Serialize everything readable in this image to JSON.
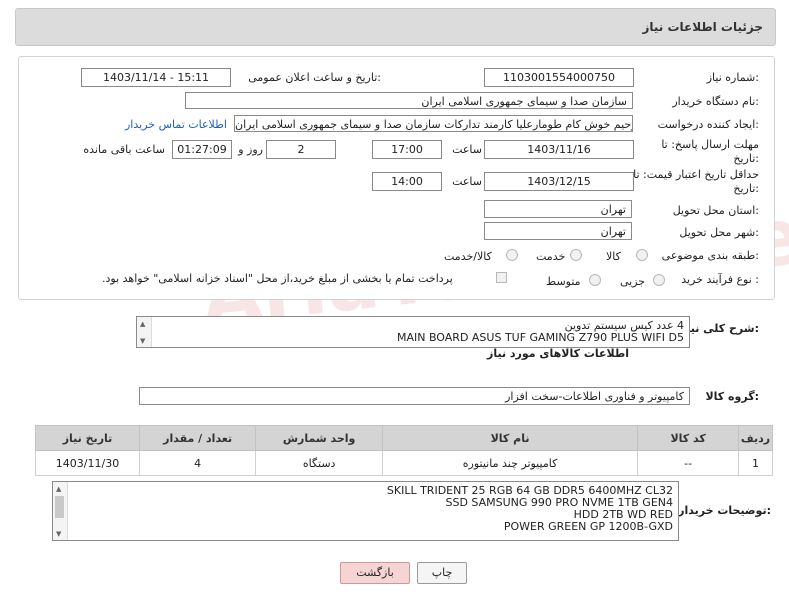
{
  "header": {
    "title": "جزئیات اطلاعات نیاز"
  },
  "fields": {
    "need_number_label": "شماره نیاز:",
    "need_number": "1103001554000750",
    "announce_label": "تاریخ و ساعت اعلان عمومی:",
    "announce_value": "1403/11/14 - 15:11",
    "buyer_org_label": "نام دستگاه خریدار:",
    "buyer_org": "سازمان صدا و سیمای جمهوری اسلامی ایران",
    "creator_label": "ایجاد کننده درخواست:",
    "creator": "رحیم خوش کام طومارعلیا کارمند تدارکات سازمان صدا و سیمای جمهوری اسلامی ایران",
    "contact_link": "اطلاعات تماس خریدار",
    "reply_deadline_label": "مهلت ارسال پاسخ: تا تاریخ:",
    "reply_date": "1403/11/16",
    "hour_label": "ساعت",
    "reply_time": "17:00",
    "days_count": "2",
    "days_label": "روز و",
    "remaining_time": "01:27:09",
    "remaining_label": "ساعت باقی مانده",
    "price_validity_label": "حداقل تاریخ اعتبار قیمت: تا تاریخ:",
    "price_date": "1403/12/15",
    "price_hour_label": "ساعت",
    "price_time": "14:00",
    "province_label": "استان محل تحویل:",
    "province": "تهران",
    "city_label": "شهر محل تحویل:",
    "city": "تهران",
    "category_label": "طبقه بندی موضوعی:",
    "category_options": [
      "کالا",
      "خدمت",
      "کالا/خدمت"
    ],
    "process_label": "نوع فرآیند خرید :",
    "process_options": [
      "جزیی",
      "متوسط"
    ],
    "payment_note": "پرداخت تمام یا بخشی از مبلغ خرید،از محل \"اسناد خزانه اسلامی\" خواهد بود."
  },
  "summary": {
    "label": "شرح کلی نیاز:",
    "lines": [
      "4 عدد کیس سیستم تدوین",
      "MAIN BOARD ASUS TUF GAMING Z790 PLUS WIFI D5"
    ]
  },
  "goods_info": {
    "title": "اطلاعات کالاهای مورد نیاز",
    "group_label": "گروه کالا:",
    "group_value": "کامپیوتر و فناوری اطلاعات-سخت افزار"
  },
  "table": {
    "headers": [
      "ردیف",
      "کد کالا",
      "نام کالا",
      "واحد شمارش",
      "تعداد / مقدار",
      "تاریخ نیاز"
    ],
    "rows": [
      [
        "1",
        "--",
        "کامپیوتر چند مانیتوره",
        "دستگاه",
        "4",
        "1403/11/30"
      ]
    ]
  },
  "buyer_notes": {
    "label": "توضیحات خریدار:",
    "lines": [
      "SKILL TRIDENT 25 RGB 64 GB DDR5 6400MHZ CL32",
      "SSD SAMSUNG 990 PRO NVME 1TB GEN4",
      "HDD 2TB WD RED",
      "POWER GREEN GP 1200B-GXD"
    ]
  },
  "buttons": {
    "print": "چاپ",
    "back": "بازگشت"
  },
  "watermark": "AriaTender.neT"
}
